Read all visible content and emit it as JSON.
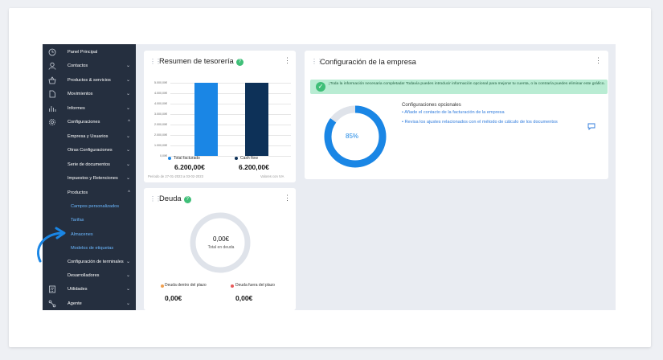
{
  "sidebar": {
    "items": [
      {
        "label": "Panel Principal",
        "icon": "clock-icon",
        "chevron": ""
      },
      {
        "label": "Contactos",
        "icon": "user-icon",
        "chevron": "⌄"
      },
      {
        "label": "Productos & servicios",
        "icon": "basket-icon",
        "chevron": "⌄"
      },
      {
        "label": "Movimientos",
        "icon": "document-icon",
        "chevron": "⌄"
      },
      {
        "label": "Informes",
        "icon": "bar-chart-icon",
        "chevron": "⌄"
      },
      {
        "label": "Configuraciones",
        "icon": "gear-icon",
        "chevron": "^"
      },
      {
        "label": "Empresa y Usuarios",
        "chevron": "⌄"
      },
      {
        "label": "Otras Configuraciones",
        "chevron": "⌄"
      },
      {
        "label": "Serie de documentos",
        "chevron": "⌄"
      },
      {
        "label": "Impuestos y Retenciones",
        "chevron": "⌄"
      },
      {
        "label": "Productos",
        "chevron": "^"
      },
      {
        "label": "Campos personalizados"
      },
      {
        "label": "Tarifas"
      },
      {
        "label": "Almacenes"
      },
      {
        "label": "Modelos de etiquetas"
      },
      {
        "label": "Configuración de terminales",
        "chevron": "⌄"
      },
      {
        "label": "Desarrolladores",
        "chevron": "⌄"
      },
      {
        "label": "Utilidades",
        "icon": "calculator-icon",
        "chevron": "⌄"
      },
      {
        "label": "Agente",
        "icon": "network-icon",
        "chevron": "⌄"
      }
    ]
  },
  "treasury": {
    "title": "Resumen de tesorería",
    "help": "?",
    "menu": "⋮",
    "y_ticks": [
      "5.000,00€",
      "4.000,00€",
      "4.000,00€",
      "3.000,00€",
      "2.000,00€",
      "2.000,00€",
      "1.000,00€",
      "0,00€"
    ],
    "legend": [
      {
        "label": "Total facturado",
        "value": "6.200,00€",
        "color": "#1a86e5"
      },
      {
        "label": "Cash flow",
        "value": "6.200,00€",
        "color": "#0d3158"
      }
    ],
    "period": "Periodo de 27-01-2023 a 03-02-2023",
    "note": "Valores con IVA"
  },
  "chart_data": {
    "type": "bar",
    "categories": [
      "Total facturado",
      "Cash flow"
    ],
    "values": [
      6200,
      6200
    ],
    "colors": [
      "#1a86e5",
      "#0d3158"
    ],
    "ylim": [
      0,
      6200
    ],
    "y_tick_labels": [
      "5.000,00€",
      "4.000,00€",
      "4.000,00€",
      "3.000,00€",
      "2.000,00€",
      "2.000,00€",
      "1.000,00€",
      "0,00€"
    ]
  },
  "config": {
    "title": "Configuración de la empresa",
    "menu": "⋮",
    "alert": "¡Toda la información necesaria completada! Todavía puedes introducir información opcional para mejorar tu cuenta, o la contraría puedes eliminar este gráfico.",
    "progress": 85,
    "progress_label": "85%",
    "optional_title": "Configuraciones opcionales",
    "links": [
      "• Añade el contacto de la facturación de la empresa",
      "• Revisa los ajustes relacionados con el método de cálculo de los documentos"
    ],
    "accent": "#1a86e5"
  },
  "debt": {
    "title": "Deuda",
    "help": "?",
    "menu": "⋮",
    "total_value": "0,00€",
    "total_label": "Total en deuda",
    "legend": [
      {
        "label": "Deuda dentro del plazo",
        "value": "0,00€",
        "color": "#f0a050"
      },
      {
        "label": "Deuda fuera del plazo",
        "value": "0,00€",
        "color": "#e85a5a"
      }
    ]
  }
}
